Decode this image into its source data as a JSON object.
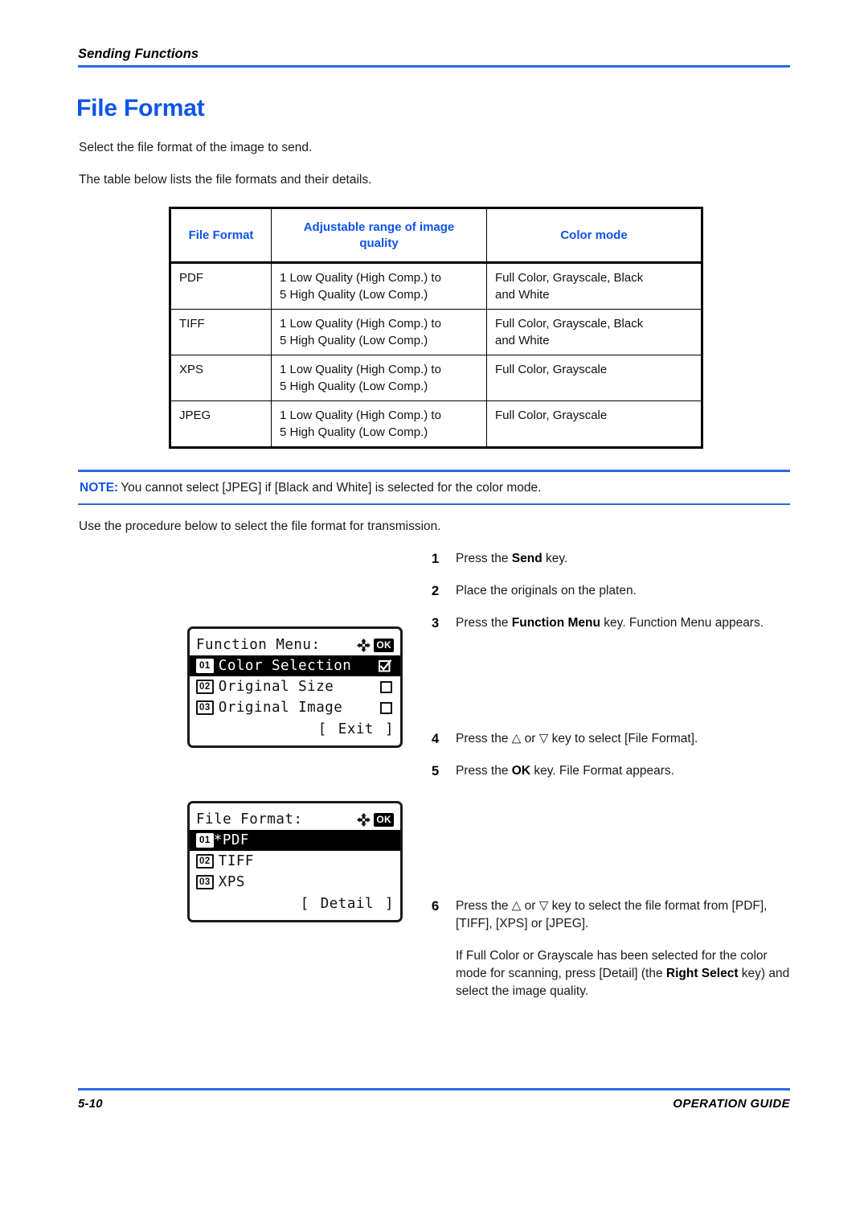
{
  "header": {
    "section": "Sending Functions"
  },
  "title": "File Format",
  "intro": {
    "line1": "Select the file format of the image to send.",
    "line2": "The table below lists the file formats and their details."
  },
  "table": {
    "columns": [
      "File Format",
      "Adjustable range of image quality",
      "Color mode"
    ],
    "header_col2_line1": "Adjustable range of image",
    "header_col2_line2": "quality",
    "rows": [
      {
        "format": "PDF",
        "range_line1": "1 Low Quality (High Comp.) to",
        "range_line2": "5 High Quality (Low Comp.)",
        "color_line1": "Full Color, Grayscale, Black",
        "color_line2": "and White"
      },
      {
        "format": "TIFF",
        "range_line1": "1 Low Quality (High Comp.) to",
        "range_line2": "5 High Quality (Low Comp.)",
        "color_line1": "Full Color, Grayscale, Black",
        "color_line2": "and White"
      },
      {
        "format": "XPS",
        "range_line1": "1 Low Quality (High Comp.) to",
        "range_line2": "5 High Quality (Low Comp.)",
        "color_line1": "Full Color, Grayscale",
        "color_line2": ""
      },
      {
        "format": "JPEG",
        "range_line1": "1 Low Quality (High Comp.) to",
        "range_line2": "5 High Quality (Low Comp.)",
        "color_line1": "Full Color, Grayscale",
        "color_line2": ""
      }
    ]
  },
  "note": {
    "label": "NOTE:",
    "text": "You cannot select [JPEG] if [Black and White] is selected for the color mode."
  },
  "procedure_lead": "Use the procedure below to select the file format for transmission.",
  "steps": [
    {
      "number": "1",
      "text_before": "Press the ",
      "bold": "Send",
      "text_after": " key."
    },
    {
      "number": "2",
      "text_before": "Place the originals on the platen.",
      "bold": "",
      "text_after": ""
    },
    {
      "number": "3",
      "text_before": "Press the ",
      "bold": "Function Menu",
      "text_after": " key. Function Menu appears."
    },
    {
      "number": "4",
      "text_before": "Press the ",
      "arrow_up": "△",
      "text_mid": " or ",
      "arrow_down": "▽",
      "text_after": " key to select [File Format]."
    },
    {
      "number": "5",
      "text_before": "Press the ",
      "bold": "OK",
      "text_after": " key. File Format appears."
    },
    {
      "number": "6",
      "text_before": "Press the ",
      "arrow_up": "△",
      "text_mid": " or ",
      "arrow_down": "▽",
      "text_after": " key to select the file format from [PDF], [TIFF], [XPS] or [JPEG].",
      "sub_before": "If Full Color or Grayscale has been selected for the color mode for scanning, press [Detail] (the ",
      "sub_bold": "Right Select",
      "sub_after": " key) and select the image quality."
    }
  ],
  "lcd_function_menu": {
    "title": "Function Menu:",
    "ok_badge": "OK",
    "items": [
      {
        "index": "01",
        "label": "Color Selection",
        "checked": true
      },
      {
        "index": "02",
        "label": "Original Size",
        "checked": false
      },
      {
        "index": "03",
        "label": "Original Image",
        "checked": false
      }
    ],
    "soft_left_bracket": "[",
    "soft_label": "Exit",
    "soft_right_bracket": "]"
  },
  "lcd_file_format": {
    "title": "File Format:",
    "ok_badge": "OK",
    "items": [
      {
        "index": "01",
        "label": "*PDF",
        "selected": true
      },
      {
        "index": "02",
        "label": "TIFF",
        "selected": false
      },
      {
        "index": "03",
        "label": "XPS",
        "selected": false
      }
    ],
    "soft_left_bracket": "[",
    "soft_label": "Detail",
    "soft_right_bracket": "]"
  },
  "footer": {
    "page": "5-10",
    "guide": "OPERATION GUIDE"
  },
  "colors": {
    "accent_blue": "#0f54e8",
    "rule_blue": "#2a6ae0",
    "text": "#1a1a1a"
  }
}
